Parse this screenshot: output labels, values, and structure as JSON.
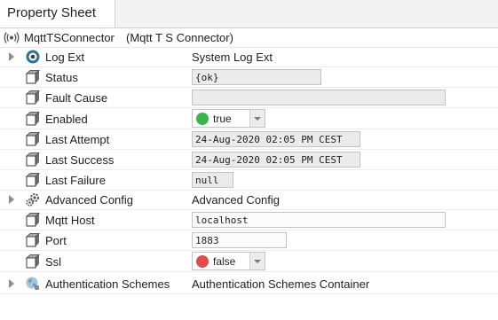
{
  "tab": {
    "label": "Property Sheet"
  },
  "header": {
    "title": "MqttTSConnector",
    "subtitle": "(Mqtt T S Connector)"
  },
  "colors": {
    "ok_green": "#3bb54a",
    "false_red": "#e24b4b"
  },
  "properties": {
    "log_ext": {
      "label": "Log Ext",
      "value": "System Log Ext",
      "icon": "log-ext-icon"
    },
    "status": {
      "label": "Status",
      "value": "{ok}"
    },
    "fault_cause": {
      "label": "Fault Cause",
      "value": ""
    },
    "enabled": {
      "label": "Enabled",
      "value": "true"
    },
    "last_attempt": {
      "label": "Last Attempt",
      "value": "24-Aug-2020 02:05 PM CEST"
    },
    "last_success": {
      "label": "Last Success",
      "value": "24-Aug-2020 02:05 PM CEST"
    },
    "last_failure": {
      "label": "Last Failure",
      "value": "null"
    },
    "advanced_config": {
      "label": "Advanced Config",
      "value": "Advanced Config",
      "icon": "gear-icon"
    },
    "mqtt_host": {
      "label": "Mqtt Host",
      "value": "localhost"
    },
    "port": {
      "label": "Port",
      "value": "1883"
    },
    "ssl": {
      "label": "Ssl",
      "value": "false"
    },
    "auth_schemes": {
      "label": "Authentication Schemes",
      "value": "Authentication Schemes Container",
      "icon": "globe-icon"
    }
  }
}
